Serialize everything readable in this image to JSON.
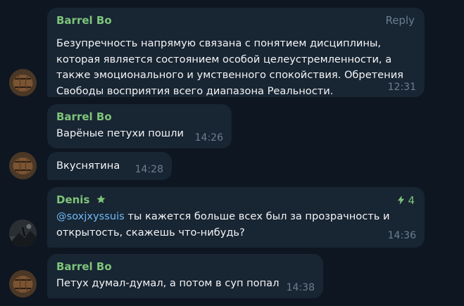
{
  "messages": [
    {
      "author": "Barrel Bo",
      "action": "Reply",
      "lines": [
        "Безупречность напрямую связана с понятием дисциплины,",
        "которая является состоянием особой целеустремленности, а",
        "также эмоционального и умственного спокойствия. Обретения",
        "Свободы восприятия всего диапазона Реальности."
      ],
      "time": "12:31"
    },
    {
      "author": "Barrel Bo",
      "text": "Варёные петухи пошли",
      "time": "14:26"
    },
    {
      "text": "Вкуснятина",
      "time": "14:28"
    },
    {
      "author": "Denis",
      "badge_count": "4",
      "mention": "@soxjxyssuis",
      "line1_rest": " ты кажется больше всех был за прозрачность и",
      "line2": "открытость, скажешь что-нибудь?",
      "time": "14:36"
    },
    {
      "author": "Barrel Bo",
      "text": "Петух думал-думал, а потом в суп попал",
      "time": "14:38"
    }
  ],
  "colors": {
    "background": "#0e1621",
    "bubble": "#182533",
    "author_name": "#7ec47a",
    "mention": "#71baf5",
    "meta": "#6d7f8f"
  },
  "icons": [
    "barrel-avatar",
    "admin-star-icon",
    "boost-icon"
  ]
}
